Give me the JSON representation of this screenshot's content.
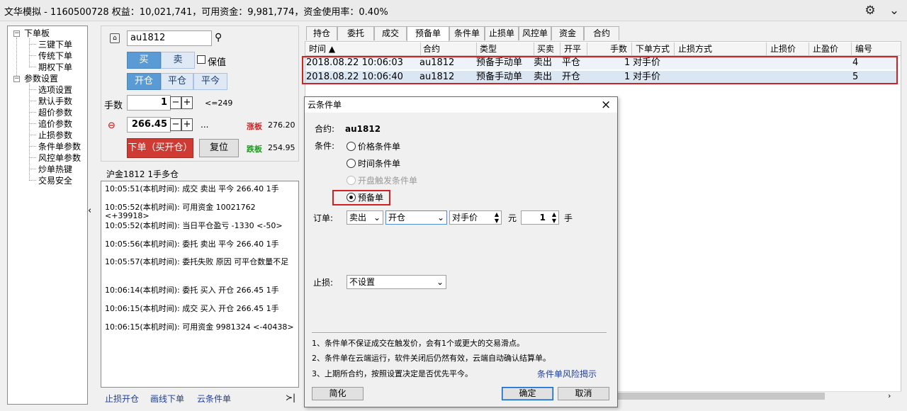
{
  "window": {
    "title": "文华模拟 - 1160500728  权益：10,021,741，可用资金：9,981,774，资金使用率：0.40%"
  },
  "tree": {
    "root1": "下单板",
    "root1_children": [
      "三键下单",
      "传统下单",
      "期权下单"
    ],
    "root2": "参数设置",
    "root2_children": [
      "选项设置",
      "默认手数",
      "超价参数",
      "追价参数",
      "止损参数",
      "条件单参数",
      "风控单参数",
      "炒单热键",
      "交易安全"
    ]
  },
  "order": {
    "contract": "au1812",
    "buy": "买",
    "sell": "卖",
    "hold_label": "保值",
    "open": "开仓",
    "close": "平仓",
    "close_today": "平今",
    "qty_label": "手数",
    "qty": "1",
    "qty_limit": "<=249",
    "price": "266.45",
    "price_more": "...",
    "limit_up_label": "涨板",
    "limit_up": "276.20",
    "limit_down_label": "跌板",
    "limit_down": "254.95",
    "submit": "下单（买开仓）",
    "reset": "复位"
  },
  "log": {
    "header": "沪金1812   1手多仓",
    "lines": [
      "10:05:51(本机时间): 成交  卖出  平今  266.40  1手",
      "10:05:52(本机时间): 可用资金 10021762  <+39918>",
      "10:05:52(本机时间): 当日平仓盈亏 -1330  <-50>",
      "10:05:56(本机时间): 委托  卖出  平今  266.40  1手",
      "10:05:57(本机时间): 委托失败  原因  可平仓数量不足",
      "10:06:14(本机时间): 委托  买入  开仓  266.45  1手",
      "10:06:15(本机时间): 成交  买入  开仓  266.45  1手",
      "10:06:15(本机时间): 可用资金 9981324  <-40438>"
    ],
    "links": [
      "止损开仓",
      "画线下单",
      "云条件单"
    ],
    "more": "≻|"
  },
  "tabs": [
    "持仓",
    "委托",
    "成交",
    "预备单",
    "条件单",
    "止损单",
    "风控单",
    "资金",
    "合约"
  ],
  "grid": {
    "headers": [
      "时间 ▲",
      "合约",
      "类型",
      "买卖",
      "开平",
      "手数",
      "下单方式",
      "止损方式",
      "止损价",
      "止盈价",
      "编号"
    ],
    "rows": [
      [
        "2018.08.22 10:06:03",
        "au1812",
        "预备手动单",
        "卖出",
        "平仓",
        "1",
        "对手价",
        "",
        "",
        "",
        "4"
      ],
      [
        "2018.08.22 10:06:40",
        "au1812",
        "预备手动单",
        "卖出",
        "开仓",
        "1",
        "对手价",
        "",
        "",
        "",
        "5"
      ]
    ]
  },
  "dialog": {
    "title": "云条件单",
    "contract_label": "合约:",
    "contract": "au1812",
    "condition_label": "条件:",
    "options": [
      "价格条件单",
      "时间条件单",
      "开盘触发条件单",
      "预备单"
    ],
    "order_label": "订单:",
    "side": "卖出",
    "offset": "开仓",
    "price_type": "对手价",
    "unit": "元",
    "qty": "1",
    "qty_unit": "手",
    "stop_label": "止损:",
    "stop": "不设置",
    "notes": [
      "1、条件单不保证成交在触发价，会有1个或更大的交易滑点。",
      "2、条件单在云端运行，软件关闭后仍然有效，云端自动确认结算单。",
      "3、上期所合约，按照设置决定是否优先平今。"
    ],
    "risk_link": "条件单风险揭示",
    "simplify": "简化",
    "ok": "确定",
    "cancel": "取消"
  },
  "colors": {
    "accent": "#5b9bd5",
    "highlight": "#d42020",
    "up": "#d42020",
    "down": "#1a9a1a",
    "link": "#1f3f9f"
  }
}
